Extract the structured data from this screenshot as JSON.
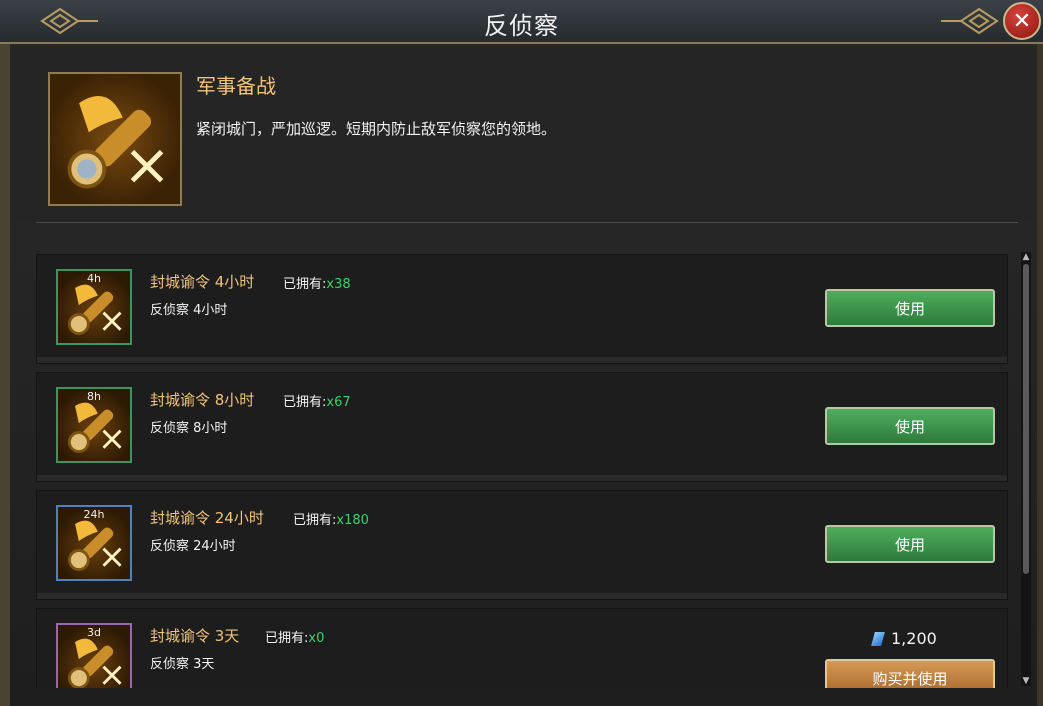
{
  "window": {
    "title": "反侦察",
    "close_label": "✕"
  },
  "header": {
    "name": "军事备战",
    "description": "紧闭城门，严加巡逻。短期内防止敌军侦察您的领地。",
    "icon": "spyglass-feather-icon"
  },
  "owned_label": "已拥有:",
  "items": [
    {
      "badge": "4h",
      "name": "封城谕令 4小时",
      "count": "x38",
      "desc": "反侦察 4小时",
      "action": "使用",
      "frame": "green"
    },
    {
      "badge": "8h",
      "name": "封城谕令 8小时",
      "count": "x67",
      "desc": "反侦察 8小时",
      "action": "使用",
      "frame": "green"
    },
    {
      "badge": "24h",
      "name": "封城谕令 24小时",
      "count": "x180",
      "desc": "反侦察 24小时",
      "action": "使用",
      "frame": "blue"
    },
    {
      "badge": "3d",
      "name": "封城谕令 3天",
      "count": "x0",
      "desc": "反侦察 3天",
      "price": "1,200",
      "action": "购买并使用",
      "frame": "purple"
    }
  ],
  "colors": {
    "accent": "#f0c27a",
    "count": "#3fd06a",
    "use_button": "#3f944d",
    "buy_button": "#c07c3c"
  }
}
